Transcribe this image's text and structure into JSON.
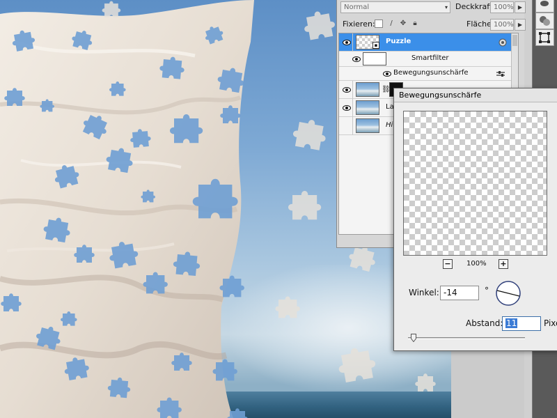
{
  "layers_panel": {
    "blend_mode": "Normal",
    "opacity_label": "Deckkraft:",
    "opacity_value": "100%",
    "lock_label": "Fixieren:",
    "fill_label": "Fläche:",
    "fill_value": "100%",
    "layers": [
      {
        "name": "Puzzle",
        "selected": true
      },
      {
        "name": "Smartfilter"
      },
      {
        "name": "Bewegungsunschärfe"
      },
      {
        "name": ""
      },
      {
        "name": "La"
      },
      {
        "name": "Hi"
      }
    ]
  },
  "dialog": {
    "title": "Bewegungsunschärfe",
    "zoom_minus": "−",
    "zoom_plus": "+",
    "zoom_level": "100%",
    "angle_label": "Winkel:",
    "angle_value": "-14",
    "degree_sign": "°",
    "distance_label": "Abstand:",
    "distance_value": "11",
    "distance_unit": "Pixe"
  },
  "icons": {
    "visibility": "eye-icon",
    "lock_transparent": "checker-icon",
    "lock_paint": "brush-icon",
    "lock_move": "move-icon",
    "lock_all": "lock-icon",
    "chain": "chain-icon",
    "smart_object": "smart-object-icon",
    "filter_options": "filter-options-icon"
  },
  "colors": {
    "selection": "#3b8fe9",
    "sky": "#7ea9d4",
    "sheet": "#ece5dc"
  }
}
